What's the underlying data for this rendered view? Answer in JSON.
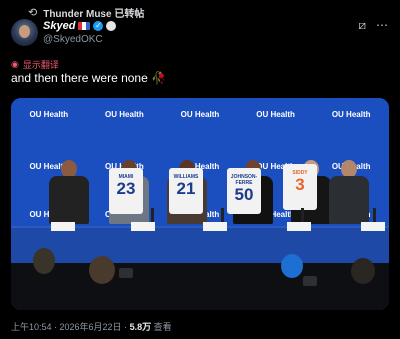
{
  "repost": {
    "text": "Thunder Muse 已转帖"
  },
  "author": {
    "name": "Skyed",
    "handle": "@SkyedOKC"
  },
  "translate_label": "显示翻译",
  "tweet": {
    "text": "and then there were none",
    "emoji": "🥀"
  },
  "media": {
    "logo_text": "OU Health",
    "jerseys": [
      {
        "name": "MIAMI",
        "number": "23"
      },
      {
        "name": "WILLIAMS",
        "number": "21"
      },
      {
        "name": "JOHNSON-FERRE",
        "number": "50"
      },
      {
        "name": "SIDDY",
        "number": "3"
      }
    ]
  },
  "meta": {
    "time": "上午10:54 · 2026年6月22日 · ",
    "views": "5.8万",
    "views_label": " 查看"
  },
  "icons": {
    "repost": "repost-icon",
    "menu": "more-icon",
    "grok": "grok-icon"
  },
  "colors": {
    "accent": "#1d9bf0",
    "translate": "#f0596f",
    "backdrop": "#1b4fc0"
  }
}
